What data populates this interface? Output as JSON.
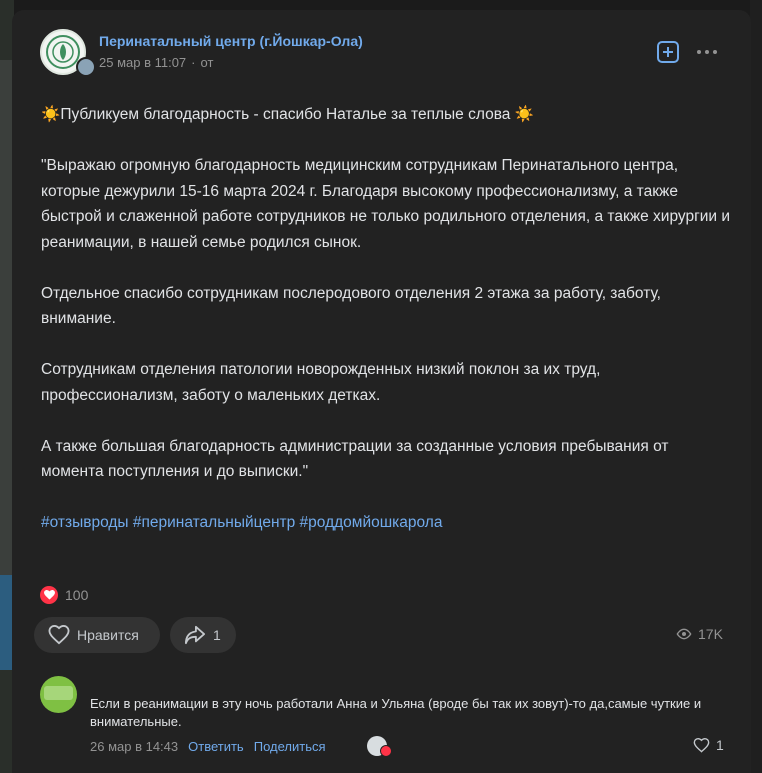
{
  "post": {
    "author": "Перинатальный центр (г.Йошкар-Ола)",
    "date": "25 мар в 11:07",
    "separator": "·",
    "from": "от",
    "headline_icon": "☀️",
    "headline": "Публикуем благодарность - спасибо Наталье за теплые слова",
    "paragraphs": [
      "\"Выражаю огромную благодарность медицинским сотрудникам Перинатального центра, которые дежурили 15-16 марта 2024 г. Благодаря высокому профессионализму, а также быстрой и слаженной работе сотрудников не только родильного отделения, а также хирургии и реанимации, в нашей семье родился сынок.",
      "Отдельное спасибо сотрудникам послеродового отделения 2 этажа за работу, заботу, внимание.",
      "Сотрудникам отделения патологии новорожденных низкий поклон за их труд, профессионализм, заботу о маленьких детках.",
      "А также большая благодарность администрации за созданные условия пребывания от момента поступления и до выписки.\""
    ],
    "hashtags": "#отзывроды #перинатальныйцентр #роддомйошкарола",
    "reaction_count": "100",
    "like_label": "Нравится",
    "share_count": "1",
    "views": "17K"
  },
  "comment": {
    "text": "Если в реанимации в эту ночь работали Анна и Ульяна (вроде бы так их зовут)-то да,самые чуткие и внимательные.",
    "date": "26 мар в 14:43",
    "reply_label": "Ответить",
    "share_label": "Поделиться",
    "like_count": "1"
  },
  "colors": {
    "link": "#71aaeb",
    "heart": "#ff3347",
    "card_bg": "#222222"
  },
  "icons": [
    "add-icon",
    "more-icon",
    "heart-icon",
    "share-icon",
    "eye-icon",
    "sun-icon"
  ]
}
